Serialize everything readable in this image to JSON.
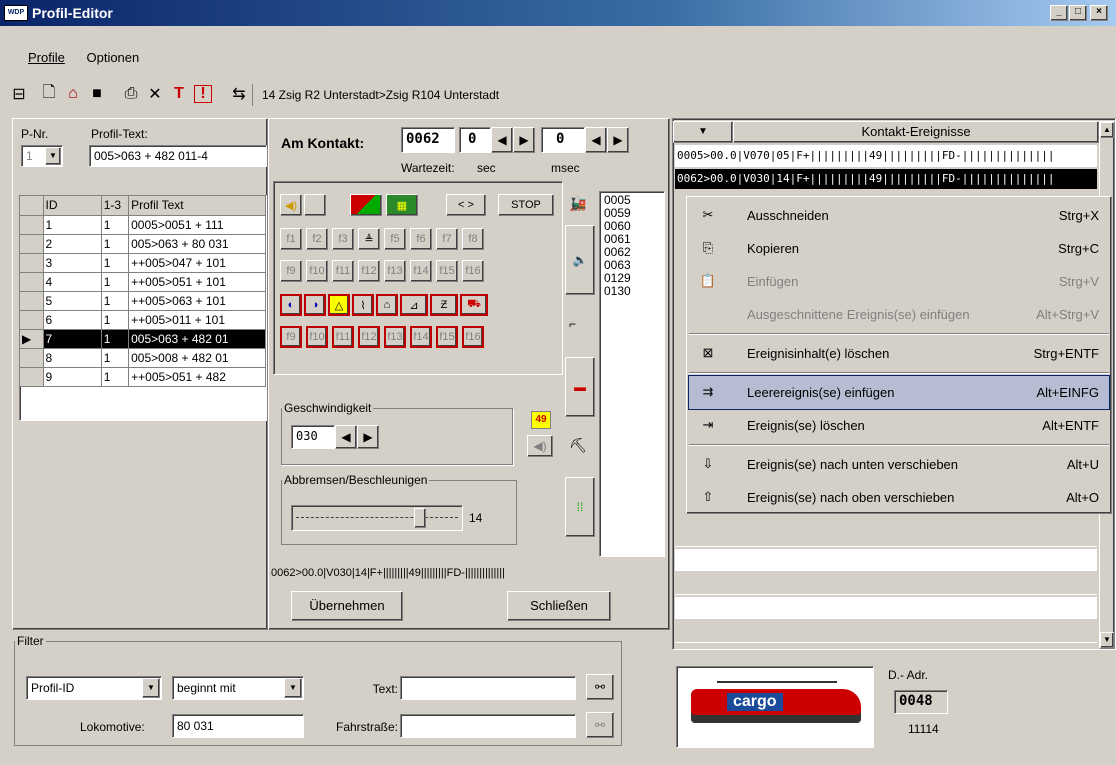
{
  "window": {
    "title": "Profil-Editor",
    "icon": "wdp-app-icon"
  },
  "menu": [
    "Profile",
    "Optionen"
  ],
  "toolbar": {
    "route": "14 Zsig R2 Unterstadt>Zsig R104 Unterstadt"
  },
  "pnr": {
    "label": "P-Nr.",
    "value": "1"
  },
  "profiltext": {
    "label": "Profil-Text:",
    "value": "005>063 + 482 011-4"
  },
  "table": {
    "headers": [
      "ID",
      "1-3",
      "Profil Text"
    ],
    "rows": [
      {
        "id": "1",
        "k": "1",
        "text": "0005>0051 + 111"
      },
      {
        "id": "2",
        "k": "1",
        "text": "005>063 + 80 031"
      },
      {
        "id": "3",
        "k": "1",
        "text": "++005>047 + 101"
      },
      {
        "id": "4",
        "k": "1",
        "text": "++005>051 + 101"
      },
      {
        "id": "5",
        "k": "1",
        "text": "++005>063 + 101"
      },
      {
        "id": "6",
        "k": "1",
        "text": "++005>011 + 101"
      },
      {
        "id": "7",
        "k": "1",
        "text": "005>063 + 482 01"
      },
      {
        "id": "8",
        "k": "1",
        "text": "005>008 + 482 01"
      },
      {
        "id": "9",
        "k": "1",
        "text": "++005>051 + 482"
      }
    ],
    "selected_index": 6
  },
  "kontakt": {
    "label": "Am Kontakt:",
    "value": "0062",
    "sec": "0",
    "msec": "0",
    "wartezeit": "Wartezeit:",
    "sec_label": "sec",
    "msec_label": "msec",
    "list": [
      "0005",
      "0059",
      "0060",
      "0061",
      "0062",
      "0063",
      "0129",
      "0130"
    ],
    "nav": "< >",
    "stop": "STOP",
    "f_row1": [
      "f1",
      "f2",
      "f3",
      "",
      "f5",
      "f6",
      "f7",
      "f8"
    ],
    "f_row2": [
      "f9",
      "f10",
      "f11",
      "f12",
      "f13",
      "f14",
      "f15",
      "f16"
    ],
    "f_row4": [
      "f9",
      "f10",
      "f11",
      "f12",
      "f13",
      "f14",
      "f15",
      "f16"
    ],
    "speed_group": "Geschwindigkeit",
    "speed": "030",
    "badge": "49",
    "brake_group": "Abbremsen/Beschleunigen",
    "brake": "14",
    "status": "0062>00.0|V030|14|F+|||||||||49|||||||||FD-||||||||||||||",
    "ok": "Übernehmen",
    "close": "Schließen"
  },
  "events": {
    "header": "Kontakt-Ereignisse",
    "row1": "0005>00.0|V070|05|F+|||||||||49|||||||||FD-||||||||||||||",
    "row2": "0062>00.0|V030|14|F+|||||||||49|||||||||FD-||||||||||||||"
  },
  "context_menu": [
    {
      "label": "Ausschneiden",
      "shortcut": "Strg+X",
      "icon": "scissors-icon",
      "disabled": false
    },
    {
      "label": "Kopieren",
      "shortcut": "Strg+C",
      "icon": "copy-icon",
      "disabled": false
    },
    {
      "label": "Einfügen",
      "shortcut": "Strg+V",
      "icon": "paste-icon",
      "disabled": true
    },
    {
      "label": "Ausgeschnittene Ereignis(se) einfügen",
      "shortcut": "Alt+Strg+V",
      "icon": "",
      "disabled": true
    },
    {
      "label": "Ereignisinhalt(e) löschen",
      "shortcut": "Strg+ENTF",
      "icon": "clear-icon",
      "disabled": false
    },
    {
      "label": "Leerereignis(se) einfügen",
      "shortcut": "Alt+EINFG",
      "icon": "insert-empty-icon",
      "disabled": false,
      "highlighted": true
    },
    {
      "label": "Ereignis(se) löschen",
      "shortcut": "Alt+ENTF",
      "icon": "delete-event-icon",
      "disabled": false
    },
    {
      "label": "Ereignis(se) nach unten verschieben",
      "shortcut": "Alt+U",
      "icon": "move-down-icon",
      "disabled": false
    },
    {
      "label": "Ereignis(se) nach oben verschieben",
      "shortcut": "Alt+O",
      "icon": "move-up-icon",
      "disabled": false
    }
  ],
  "filter": {
    "group": "Filter",
    "field": "Profil-ID",
    "op": "beginnt mit",
    "text_label": "Text:",
    "text_value": "",
    "loco_label": "Lokomotive:",
    "loco_value": "80 031",
    "route_label": "Fahrstraße:",
    "route_value": ""
  },
  "loco": {
    "image_text": "cargo",
    "dadr_label": "D.- Adr.",
    "dadr": "0048",
    "number": "11114"
  }
}
